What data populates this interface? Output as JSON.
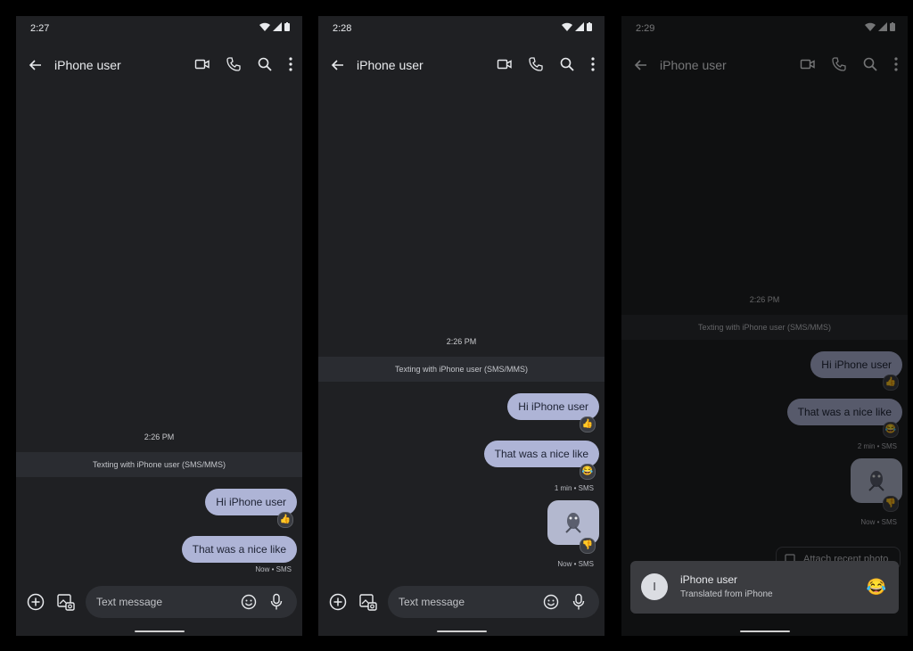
{
  "screens": [
    {
      "status": {
        "time": "2:27"
      },
      "header": {
        "title": "iPhone user"
      },
      "conversation": {
        "timestamp": "2:26 PM",
        "banner": "Texting with iPhone user (SMS/MMS)",
        "messages": [
          {
            "text": "Hi iPhone user",
            "reaction": "👍"
          },
          {
            "text": "That was a nice like",
            "meta": "Now • SMS"
          }
        ]
      },
      "composer": {
        "placeholder": "Text message"
      }
    },
    {
      "status": {
        "time": "2:28"
      },
      "header": {
        "title": "iPhone user"
      },
      "conversation": {
        "timestamp": "2:26 PM",
        "banner": "Texting with iPhone user (SMS/MMS)",
        "messages": [
          {
            "text": "Hi iPhone user",
            "reaction": "👍"
          },
          {
            "text": "That was a nice like",
            "reaction": "😂",
            "meta": "1 min • SMS"
          },
          {
            "type": "image",
            "reaction": "👎",
            "meta": "Now • SMS"
          }
        ]
      },
      "composer": {
        "placeholder": "Text message"
      }
    },
    {
      "status": {
        "time": "2:29"
      },
      "header": {
        "title": "iPhone user"
      },
      "conversation": {
        "timestamp": "2:26 PM",
        "banner": "Texting with iPhone user (SMS/MMS)",
        "messages": [
          {
            "text": "Hi iPhone user",
            "reaction": "👍"
          },
          {
            "text": "That was a nice like",
            "reaction": "😂",
            "meta": "2 min • SMS"
          },
          {
            "type": "image",
            "reaction": "👎",
            "meta": "Now • SMS"
          }
        ],
        "attach_chip": "Attach recent photo"
      },
      "notification": {
        "avatar_initial": "I",
        "title": "iPhone user",
        "subtitle": "Translated from iPhone",
        "emoji": "😂"
      }
    }
  ]
}
